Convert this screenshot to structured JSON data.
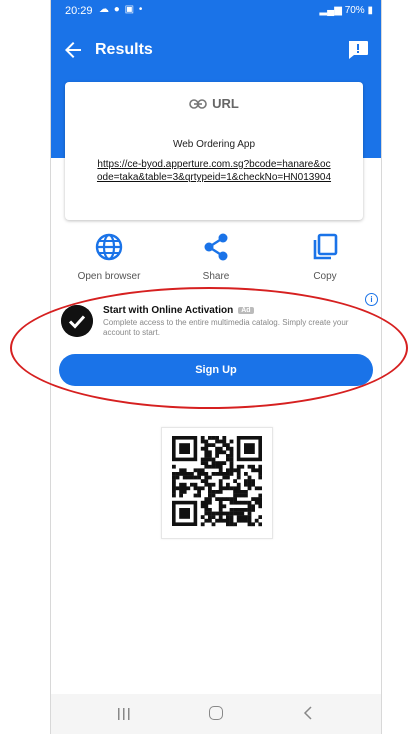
{
  "status_bar": {
    "time": "20:29",
    "left_icons": "☁ ● ▣ •",
    "battery": "70%"
  },
  "header": {
    "title": "Results"
  },
  "result_card": {
    "type_label": "URL",
    "subtitle": "Web Ordering App",
    "url": "https://ce-byod.apperture.com.sg?bcode=hanare&ocode=taka&table=3&qrtypeid=1&checkNo=HN013904"
  },
  "actions": [
    {
      "label": "Open browser",
      "icon": "globe-icon"
    },
    {
      "label": "Share",
      "icon": "share-icon"
    },
    {
      "label": "Copy",
      "icon": "copy-icon"
    }
  ],
  "ad": {
    "title": "Start with Online Activation",
    "badge": "Ad",
    "description": "Complete access to the entire multimedia catalog. Simply create your account to start.",
    "button_label": "Sign Up",
    "info_icon": "info-icon"
  },
  "colors": {
    "primary": "#1a73e8",
    "highlight": "#d62020"
  }
}
